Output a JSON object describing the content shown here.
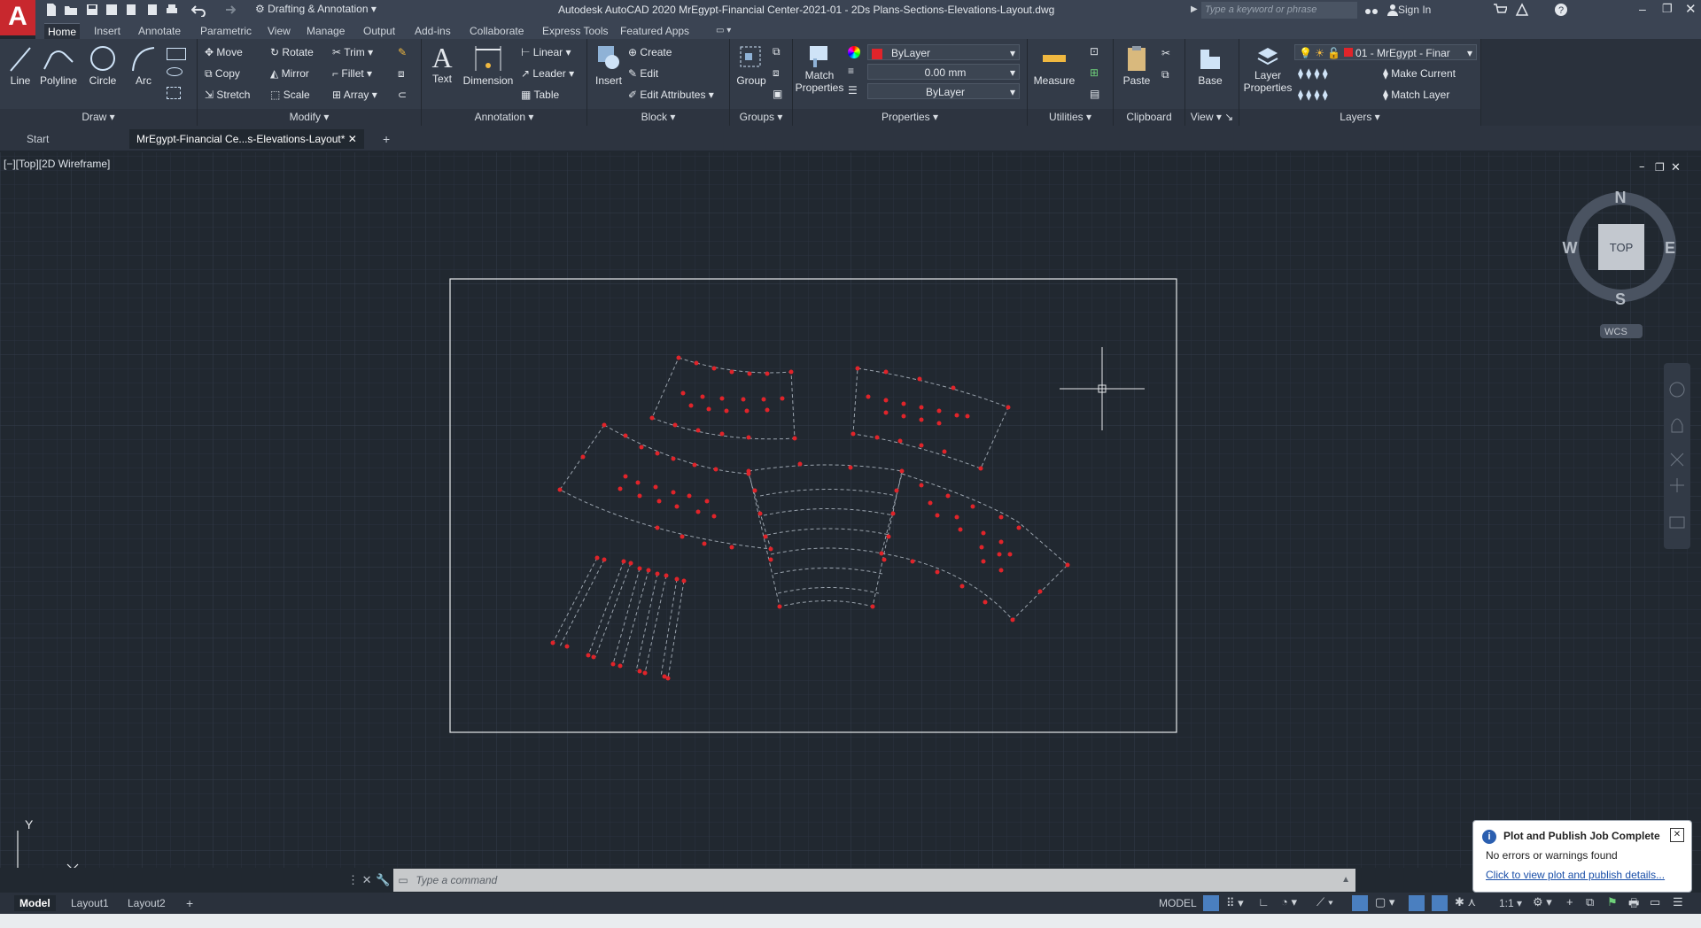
{
  "app": {
    "title": "Autodesk AutoCAD 2020    MrEgypt-Financial Center-2021-01 - 2Ds Plans-Sections-Elevations-Layout.dwg",
    "workspace": "Drafting & Annotation",
    "search_placeholder": "Type a keyword or phrase",
    "sign_in": "Sign In"
  },
  "ribbon_tabs": [
    "Home",
    "Insert",
    "Annotate",
    "Parametric",
    "View",
    "Manage",
    "Output",
    "Add-ins",
    "Collaborate",
    "Express Tools",
    "Featured Apps"
  ],
  "panels": {
    "draw": {
      "title": "Draw",
      "tools": [
        "Line",
        "Polyline",
        "Circle",
        "Arc"
      ]
    },
    "modify": {
      "title": "Modify",
      "tools": [
        "Move",
        "Rotate",
        "Trim",
        "Copy",
        "Mirror",
        "Fillet",
        "Stretch",
        "Scale",
        "Array"
      ]
    },
    "annotation": {
      "title": "Annotation",
      "big": [
        "Text",
        "Dimension"
      ],
      "tools": [
        "Linear",
        "Leader",
        "Table"
      ]
    },
    "block": {
      "title": "Block",
      "big": "Insert",
      "tools": [
        "Create",
        "Edit",
        "Edit Attributes"
      ]
    },
    "groups": {
      "title": "Groups",
      "big": "Group"
    },
    "properties": {
      "title": "Properties",
      "big": "Match Properties",
      "color": "ByLayer",
      "lineweight": "0.00 mm",
      "linetype": "ByLayer"
    },
    "utilities": {
      "title": "Utilities",
      "big": "Measure"
    },
    "clipboard": {
      "title": "Clipboard",
      "big": "Paste"
    },
    "view": {
      "title": "View",
      "big": "Base"
    },
    "layers": {
      "title": "Layers",
      "big": "Layer Properties",
      "layer": "01 - MrEgypt - Finar",
      "tools": [
        "Make Current",
        "Match Layer"
      ]
    }
  },
  "file_tabs": [
    "Start",
    "MrEgypt-Financial Ce...s-Elevations-Layout*"
  ],
  "viewport_label": "[−][Top][2D Wireframe]",
  "viewcube": {
    "N": "N",
    "S": "S",
    "E": "E",
    "W": "W",
    "face": "TOP",
    "wcs": "WCS"
  },
  "ucs": {
    "x": "X",
    "y": "Y"
  },
  "command": {
    "placeholder": "Type  a  command"
  },
  "layout_tabs": [
    "Model",
    "Layout1",
    "Layout2"
  ],
  "status": {
    "mode": "MODEL",
    "scale": "1:1"
  },
  "notification": {
    "title": "Plot and Publish Job Complete",
    "message": "No errors or warnings found",
    "link": "Click to view plot and publish details..."
  },
  "colors": {
    "accent": "#c8282e",
    "point": "#e0242a",
    "background": "#212830"
  }
}
